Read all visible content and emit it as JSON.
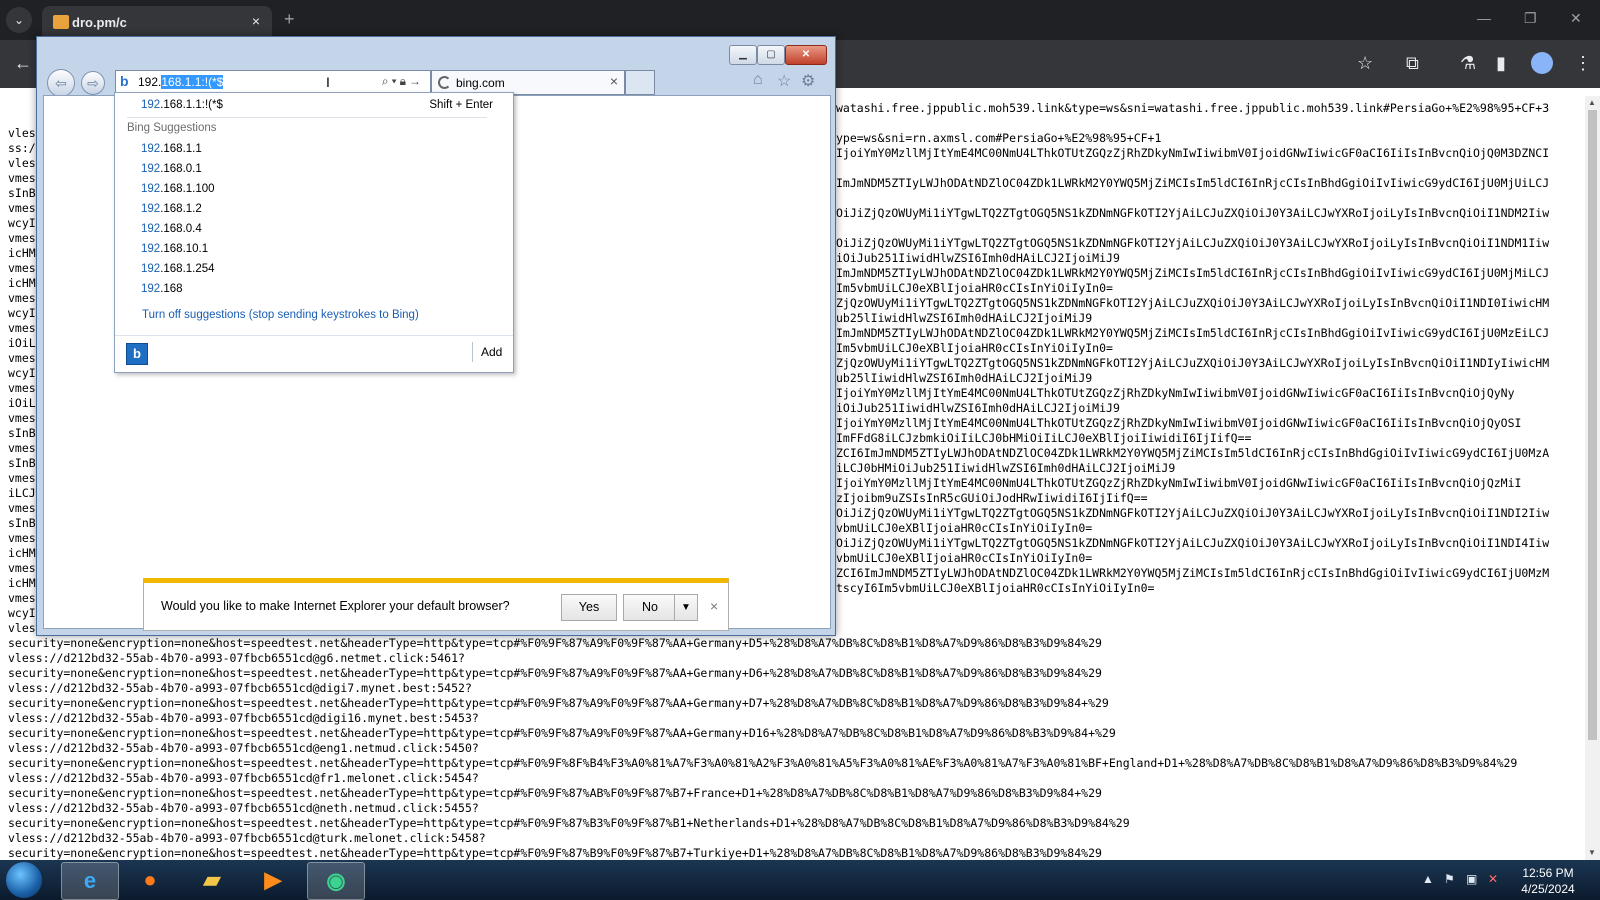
{
  "chrome": {
    "tab_title": "dro.pm/c",
    "tab_close": "×",
    "new_tab": "+",
    "window_controls": {
      "minimize": "—",
      "maximize": "❐",
      "close": "✕"
    },
    "toolbar_icons": [
      "back-icon",
      "star-icon",
      "extensions-icon",
      "labs-icon",
      "sidepanel-icon",
      "profile-icon",
      "menu-icon"
    ],
    "page_lines": [
      "vles",
      "ss:/",
      "vles",
      "vmes",
      "sInB",
      "vmes",
      "wcyI",
      "vmes",
      "icHM",
      "vmes",
      "icHM",
      "vmes",
      "wcyI",
      "vmes",
      "iOiL",
      "vmes",
      "wcyI",
      "vmes",
      "iOiL",
      "vmes",
      "sInB",
      "vmes",
      "sInB",
      "vmes",
      "iLCJ",
      "vmes",
      "sInB",
      "vmes",
      "icHM",
      "vmes",
      "icHM",
      "vmes",
      "wcyI",
      "vles",
      "security=none&encryption=none&host=speedtest.net&headerType=http&type=tcp#%F0%9F%87%A9%F0%9F%87%AA+Germany+D5+%28%D8%A7%DB%8C%D8%B1%D8%A7%D9%86%D8%B3%D9%84%29",
      "vless://d212bd32-55ab-4b70-a993-07fbcb6551cd@g6.netmet.click:5461?",
      "security=none&encryption=none&host=speedtest.net&headerType=http&type=tcp#%F0%9F%87%A9%F0%9F%87%AA+Germany+D6+%28%D8%A7%DB%8C%D8%B1%D8%A7%D9%86%D8%B3%D9%84%29",
      "vless://d212bd32-55ab-4b70-a993-07fbcb6551cd@digi7.mynet.best:5452?",
      "security=none&encryption=none&host=speedtest.net&headerType=http&type=tcp#%F0%9F%87%A9%F0%9F%87%AA+Germany+D7+%28%D8%A7%DB%8C%D8%B1%D8%A7%D9%86%D8%B3%D9%84+%29",
      "vless://d212bd32-55ab-4b70-a993-07fbcb6551cd@digi16.mynet.best:5453?",
      "security=none&encryption=none&host=speedtest.net&headerType=http&type=tcp#%F0%9F%87%A9%F0%9F%87%AA+Germany+D16+%28%D8%A7%DB%8C%D8%B1%D8%A7%D9%86%D8%B3%D9%84+%29",
      "vless://d212bd32-55ab-4b70-a993-07fbcb6551cd@eng1.netmud.click:5450?",
      "security=none&encryption=none&host=speedtest.net&headerType=http&type=tcp#%F0%9F%8F%B4%F3%A0%81%A7%F3%A0%81%A2%F3%A0%81%A5%F3%A0%81%AE%F3%A0%81%A7%F3%A0%81%BF+England+D1+%28%D8%A7%DB%8C%D8%B1%D8%A7%D9%86%D8%B3%D9%84%29",
      "vless://d212bd32-55ab-4b70-a993-07fbcb6551cd@fr1.melonet.click:5454?",
      "security=none&encryption=none&host=speedtest.net&headerType=http&type=tcp#%F0%9F%87%AB%F0%9F%87%B7+France+D1+%28%D8%A7%DB%8C%D8%B1%D8%A7%D9%86%D8%B3%D9%84+%29",
      "vless://d212bd32-55ab-4b70-a993-07fbcb6551cd@neth.netmud.click:5455?",
      "security=none&encryption=none&host=speedtest.net&headerType=http&type=tcp#%F0%9F%87%B3%F0%9F%87%B1+Netherlands+D1+%28%D8%A7%DB%8C%D8%B1%D8%A7%D9%86%D8%B3%D9%84%29",
      "vless://d212bd32-55ab-4b70-a993-07fbcb6551cd@turk.melonet.click:5458?",
      "security=none&encryption=none&host=speedtest.net&headerType=http&type=tcp#%F0%9F%87%B9%F0%9F%87%B7+Turkiye+D1+%28%D8%A7%DB%8C%D8%B1%D8%A7%D9%86%D8%B3%D9%84%29"
    ],
    "right_lines": [
      "watashi.free.jppublic.moh539.link&type=ws&sni=watashi.free.jppublic.moh539.link#PersiaGo+%E2%98%95+CF+3",
      "",
      "ype=ws&sni=rn.axmsl.com#PersiaGo+%E2%98%95+CF+1",
      "IjoiYmY0MzllMjItYmE4MC00NmU4LThkOTUtZGQzZjRhZDkyNmIwIiwibmV0IjoidGNwIiwicGF0aCI6IiIsInBvcnQiOjQ0M3DZNCI",
      "",
      "ImJmNDM5ZTIyLWJhODAtNDZlOC04ZDk1LWRkM2Y0YWQ5MjZiMCIsIm5ldCI6InRjcCIsInBhdGgiOiIvIiwicG9ydCI6IjU0MjUiLCJ",
      "",
      "OiJiZjQzOWUyMi1iYTgwLTQ2ZTgtOGQ5NS1kZDNmNGFkOTI2YjAiLCJuZXQiOiJ0Y3AiLCJwYXRoIjoiLyIsInBvcnQiOiI1NDM2Iiw",
      "",
      "OiJiZjQzOWUyMi1iYTgwLTQ2ZTgtOGQ5NS1kZDNmNGFkOTI2YjAiLCJuZXQiOiJ0Y3AiLCJwYXRoIjoiLyIsInBvcnQiOiI1NDM1Iiw",
      "iOiJub251IiwidHlwZSI6Imh0dHAiLCJ2IjoiMiJ9",
      "ImJmNDM5ZTIyLWJhODAtNDZlOC04ZDk1LWRkM2Y0YWQ5MjZiMCIsIm5ldCI6InRjcCIsInBhdGgiOiIvIiwicG9ydCI6IjU0MjMiLCJ",
      "Im5vbmUiLCJ0eXBlIjoiaHR0cCIsInYiOiIyIn0=",
      "ZjQzOWUyMi1iYTgwLTQ2ZTgtOGQ5NS1kZDNmNGFkOTI2YjAiLCJuZXQiOiJ0Y3AiLCJwYXRoIjoiLyIsInBvcnQiOiI1NDI0IiwicHM",
      "ub25lIiwidHlwZSI6Imh0dHAiLCJ2IjoiMiJ9",
      "ImJmNDM5ZTIyLWJhODAtNDZlOC04ZDk1LWRkM2Y0YWQ5MjZiMCIsIm5ldCI6InRjcCIsInBhdGgiOiIvIiwicG9ydCI6IjU0MzEiLCJ",
      "Im5vbmUiLCJ0eXBlIjoiaHR0cCIsInYiOiIyIn0=",
      "ZjQzOWUyMi1iYTgwLTQ2ZTgtOGQ5NS1kZDNmNGFkOTI2YjAiLCJuZXQiOiJ0Y3AiLCJwYXRoIjoiLyIsInBvcnQiOiI1NDIyIiwicHM",
      "ub25lIiwidHlwZSI6Imh0dHAiLCJ2IjoiMiJ9",
      "IjoiYmY0MzllMjItYmE4MC00NmU4LThkOTUtZGQzZjRhZDkyNmIwIiwibmV0IjoidGNwIiwicGF0aCI6IiIsInBvcnQiOjQyNy",
      "iOiJub251IiwidHlwZSI6Imh0dHAiLCJ2IjoiMiJ9",
      "IjoiYmY0MzllMjItYmE4MC00NmU4LThkOTUtZGQzZjRhZDkyNmIwIiwibmV0IjoidGNwIiwicGF0aCI6IiIsInBvcnQiOjQyOSI",
      "ImFFdG8iLCJzbmkiOiIiLCJ0bHMiOiIiLCJ0eXBlIjoiIiwidiI6IjIifQ==",
      "ZCI6ImJmNDM5ZTIyLWJhODAtNDZlOC04ZDk1LWRkM2Y0YWQ5MjZiMCIsIm5ldCI6InRjcCIsInBhdGgiOiIvIiwicG9ydCI6IjU0MzA",
      "iLCJ0bHMiOiJub251IiwidHlwZSI6Imh0dHAiLCJ2IjoiMiJ9",
      "IjoiYmY0MzllMjItYmE4MC00NmU4LThkOTUtZGQzZjRhZDkyNmIwIiwibmV0IjoidGNwIiwicGF0aCI6IiIsInBvcnQiOjQzMiI",
      "zIjoibm9uZSIsInR5cGUiOiJodHRwIiwidiI6IjIifQ==",
      "OiJiZjQzOWUyMi1iYTgwLTQ2ZTgtOGQ5NS1kZDNmNGFkOTI2YjAiLCJuZXQiOiJ0Y3AiLCJwYXRoIjoiLyIsInBvcnQiOiI1NDI2Iiw",
      "vbmUiLCJ0eXBlIjoiaHR0cCIsInYiOiIyIn0=",
      "OiJiZjQzOWUyMi1iYTgwLTQ2ZTgtOGQ5NS1kZDNmNGFkOTI2YjAiLCJuZXQiOiJ0Y3AiLCJwYXRoIjoiLyIsInBvcnQiOiI1NDI4Iiw",
      "vbmUiLCJ0eXBlIjoiaHR0cCIsInYiOiIyIn0=",
      "ZCI6ImJmNDM5ZTIyLWJhODAtNDZlOC04ZDk1LWRkM2Y0YWQ5MjZiMCIsIm5ldCI6InRjcCIsInBhdGgiOiIvIiwicG9ydCI6IjU0MzM",
      "tscyI6Im5vbmUiLCJ0eXBlIjoiaHR0cCIsInYiOiIyIn0=",
      "",
      "%A7%DB%8C%D8%B1%D8%A7%D9%86%D8%B3%D9%84%29"
    ]
  },
  "ie": {
    "address": {
      "typed": "192.",
      "selected": "168.1.1:!(*$",
      "search_icon": "search-icon",
      "lock_icon": "lock-icon",
      "go_icon": "go-arrow-icon"
    },
    "tab": {
      "label": "bing.com",
      "close": "×"
    },
    "dropdown": {
      "first": {
        "prefix": "192",
        "rest": ".168.1.1:!(*$",
        "shortcut": "Shift + Enter"
      },
      "header": "Bing Suggestions",
      "suggestions": [
        {
          "prefix": "192",
          "rest": ".168.1.1"
        },
        {
          "prefix": "192",
          "rest": ".168.0.1"
        },
        {
          "prefix": "192",
          "rest": ".168.1.100"
        },
        {
          "prefix": "192",
          "rest": ".168.1.2"
        },
        {
          "prefix": "192",
          "rest": ".168.0.4"
        },
        {
          "prefix": "192",
          "rest": ".168.10.1"
        },
        {
          "prefix": "192",
          "rest": ".168.1.254"
        },
        {
          "prefix": "192",
          "rest": ".168"
        }
      ],
      "turn_off": "Turn off suggestions (stop sending keystrokes to Bing)",
      "add": "Add"
    },
    "notification": {
      "message": "Would you like to make Internet Explorer your default browser?",
      "yes": "Yes",
      "no": "No",
      "close": "×"
    }
  },
  "taskbar": {
    "time": "12:56 PM",
    "date": "4/25/2024",
    "apps": [
      "internet-explorer",
      "firefox",
      "file-explorer",
      "media-player",
      "green-app"
    ]
  }
}
